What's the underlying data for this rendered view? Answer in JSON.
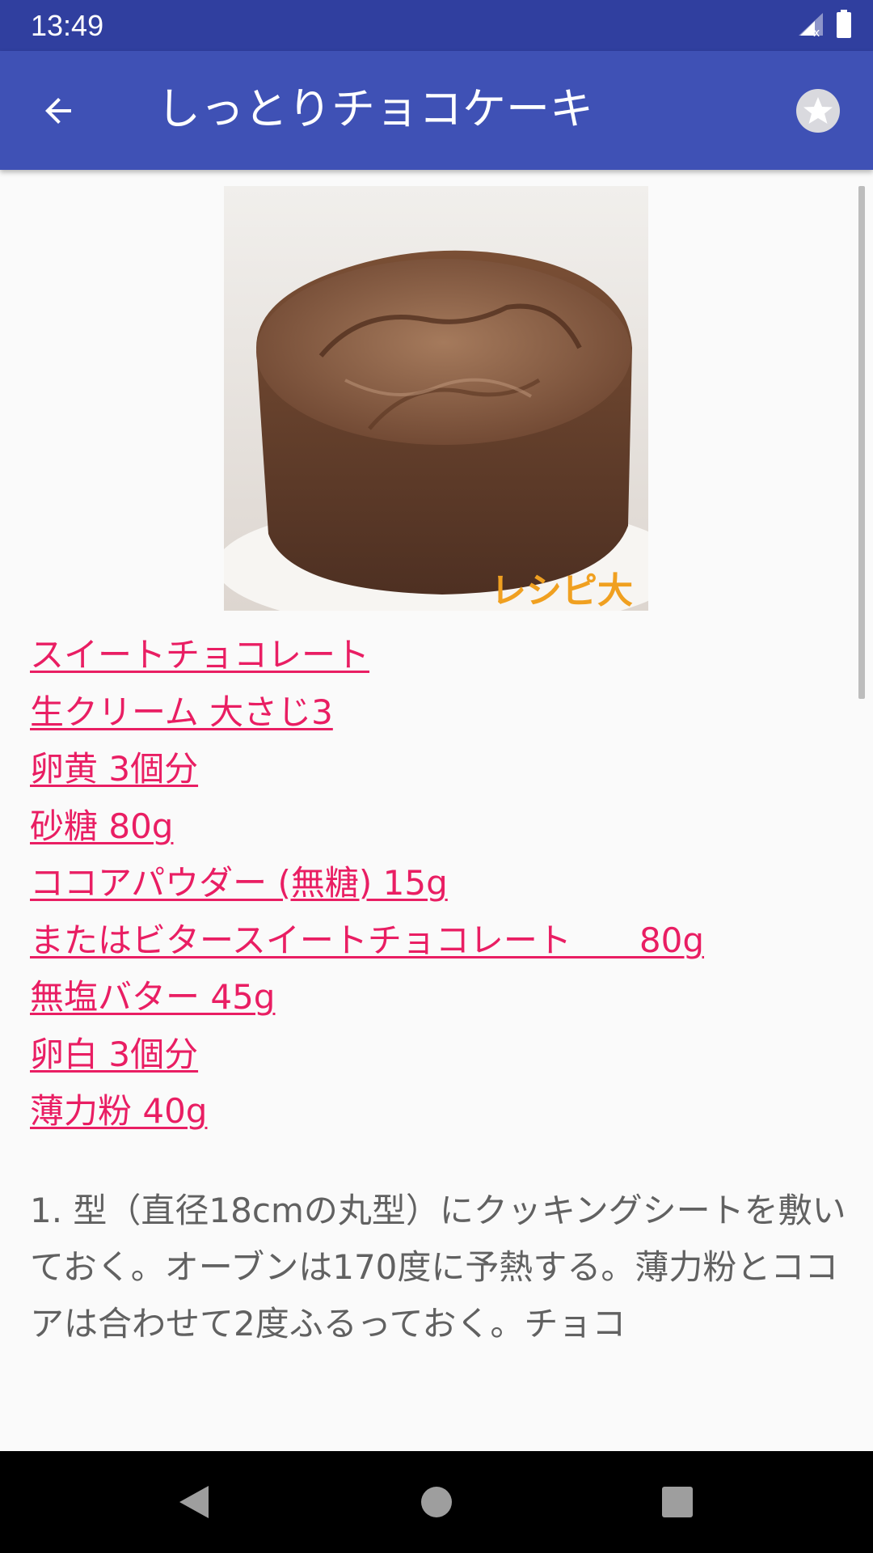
{
  "status_bar": {
    "time": "13:49",
    "signal_icon": "cell-signal-no-data-icon",
    "battery_icon": "battery-full-icon"
  },
  "app_bar": {
    "title": "しっとりチョコケーキ",
    "back_icon": "arrow-back-icon",
    "favorite_icon": "star-icon",
    "background_color": "#3f51b5",
    "status_color": "#303f9f"
  },
  "recipe": {
    "image_alt": "chocolate-cake-photo",
    "image_watermark": "レシピ大",
    "ingredients": [
      "スイートチョコレート",
      "生クリーム 大さじ3",
      "卵黄 3個分",
      "砂糖 80g",
      "ココアパウダー (無糖) 15g",
      "またはビタースイートチョコレート　　80g",
      "無塩バター 45g",
      "卵白 3個分",
      "薄力粉 40g"
    ],
    "ingredient_color": "#e91e63",
    "instructions": "1. 型（直径18cmの丸型）にクッキングシートを敷いておく。オーブンは170度に予熱する。薄力粉とココアは合わせて2度ふるっておく。チョコ"
  },
  "nav_bar": {
    "back_icon": "nav-back-triangle-icon",
    "home_icon": "nav-home-circle-icon",
    "recents_icon": "nav-recents-square-icon"
  }
}
